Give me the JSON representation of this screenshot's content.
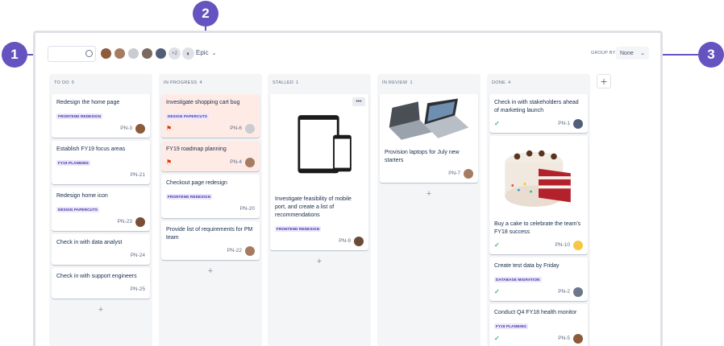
{
  "callouts": [
    "1",
    "2",
    "3"
  ],
  "toolbar": {
    "search_placeholder": "",
    "avatars_more": "+2",
    "epic_label": "Epic",
    "groupby_label": "GROUP BY",
    "groupby_value": "None"
  },
  "colors": {
    "accent": "#6554c0",
    "flagged_bg": "#ffebe6",
    "lozenge_frontend_text": "#403294",
    "lozenge_frontend_bg": "#eae6ff",
    "lozenge_papercuts_text": "#403294",
    "lozenge_fy19_text": "#403294"
  },
  "columns": [
    {
      "name": "TO DO",
      "count": "5",
      "cards": [
        {
          "title": "Redesign the home page",
          "epic": "FRONTEND REDESIGN",
          "key": "PN-3",
          "avatar": true
        },
        {
          "title": "Establish FY19 focus areas",
          "epic": "FY19 PLANNING",
          "key": "PN-21",
          "avatar": false
        },
        {
          "title": "Redesign home icon",
          "epic": "DESIGN PAPERCUTS",
          "key": "PN-23",
          "avatar": true
        },
        {
          "title": "Check in with data analyst",
          "epic": "",
          "key": "PN-24",
          "avatar": false
        },
        {
          "title": "Check in with support engineers",
          "epic": "",
          "key": "PN-25",
          "avatar": false
        }
      ]
    },
    {
      "name": "IN PROGRESS",
      "count": "4",
      "cards": [
        {
          "title": "Investigate shopping cart bug",
          "epic": "DESIGN PAPERCUTS",
          "key": "PN-6",
          "flagged": true
        },
        {
          "title": "FY19 roadmap planning",
          "epic": "",
          "key": "PN-4",
          "flagged": true
        },
        {
          "title": "Checkout page redesign",
          "epic": "FRONTEND REDESIGN",
          "key": "PN-20"
        },
        {
          "title": "Provide list of requirements for PM team",
          "epic": "",
          "key": "PN-22"
        }
      ]
    },
    {
      "name": "STALLED",
      "count": "1",
      "cards": [
        {
          "title": "Investigate feasibility of mobile port, and create a list of recommendations",
          "epic": "FRONTEND REDESIGN",
          "key": "PN-9",
          "more": "•••"
        }
      ]
    },
    {
      "name": "IN REVIEW",
      "count": "1",
      "cards": [
        {
          "title": "Provision laptops for July new starters",
          "epic": "",
          "key": "PN-7"
        }
      ]
    },
    {
      "name": "DONE",
      "count": "4",
      "cards": [
        {
          "title": "Check in with stakeholders ahead of marketing launch",
          "epic": "",
          "key": "PN-1"
        },
        {
          "title": "Buy a cake to celebrate the team's FY18 success",
          "epic": "",
          "key": "PN-10"
        },
        {
          "title": "Create test data by Friday",
          "epic": "DATABASE MIGRATION",
          "key": "PN-2"
        },
        {
          "title": "Conduct Q4 FY18 health monitor",
          "epic": "FY19 PLANNING",
          "key": "PN-5"
        }
      ]
    }
  ],
  "add_symbol": "+"
}
